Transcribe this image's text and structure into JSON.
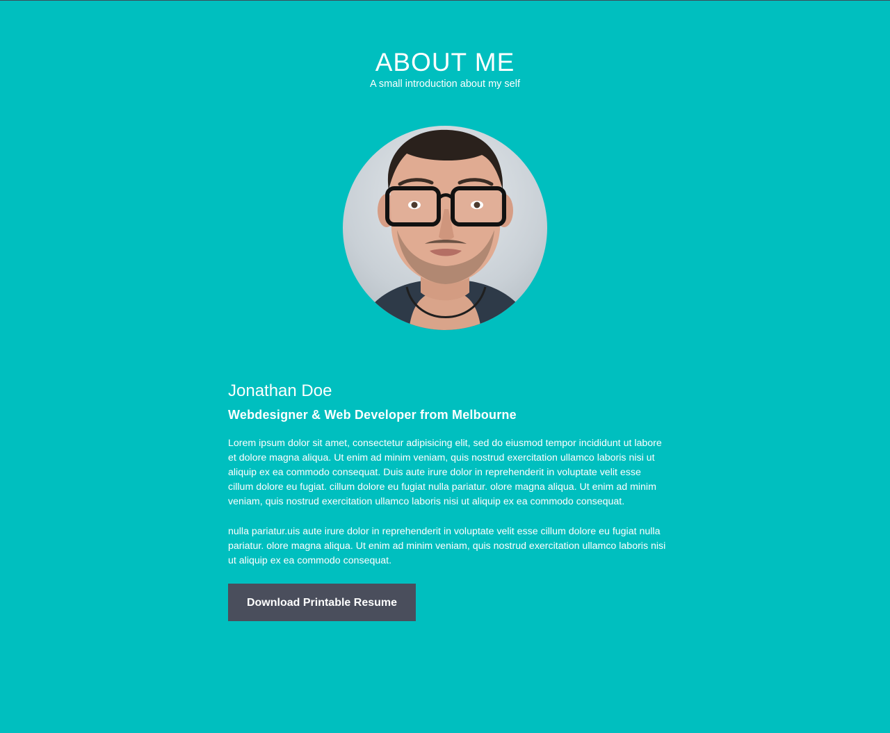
{
  "header": {
    "title": "ABOUT ME",
    "subtitle": "A small introduction about my self"
  },
  "profile": {
    "name": "Jonathan Doe",
    "role": "Webdesigner & Web Developer from Melbourne",
    "paragraphs": [
      "Lorem ipsum dolor sit amet, consectetur adipisicing elit, sed do eiusmod tempor incididunt ut labore et dolore magna aliqua. Ut enim ad minim veniam, quis nostrud exercitation ullamco laboris nisi ut aliquip ex ea commodo consequat. Duis aute irure dolor in reprehenderit in voluptate velit esse cillum dolore eu fugiat. cillum dolore eu fugiat nulla pariatur. olore magna aliqua. Ut enim ad minim veniam, quis nostrud exercitation ullamco laboris nisi ut aliquip ex ea commodo consequat.",
      "nulla pariatur.uis aute irure dolor in reprehenderit in voluptate velit esse cillum dolore eu fugiat nulla pariatur. olore magna aliqua. Ut enim ad minim veniam, quis nostrud exercitation ullamco laboris nisi ut aliquip ex ea commodo consequat."
    ]
  },
  "actions": {
    "download_label": "Download Printable Resume"
  },
  "colors": {
    "background": "#00bfbf",
    "button": "#4a4e5c",
    "text": "#ffffff"
  }
}
